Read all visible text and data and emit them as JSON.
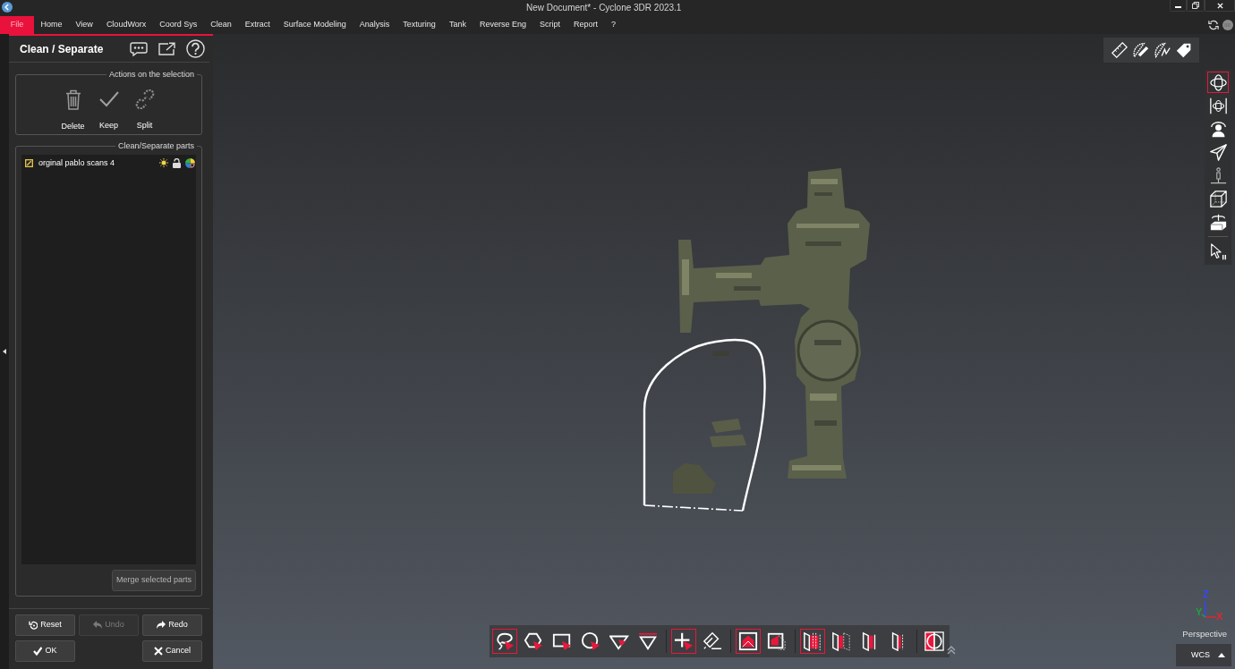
{
  "window": {
    "title": "New Document* - Cyclone 3DR 2023.1"
  },
  "menu": [
    {
      "label": "File",
      "selected": true
    },
    {
      "label": "Home",
      "selected": false
    },
    {
      "label": "View",
      "selected": false
    },
    {
      "label": "CloudWorx",
      "selected": false
    },
    {
      "label": "Coord Sys",
      "selected": false
    },
    {
      "label": "Clean",
      "selected": false
    },
    {
      "label": "Extract",
      "selected": false
    },
    {
      "label": "Surface Modeling",
      "selected": false
    },
    {
      "label": "Analysis",
      "selected": false
    },
    {
      "label": "Texturing",
      "selected": false
    },
    {
      "label": "Tank",
      "selected": false
    },
    {
      "label": "Reverse Eng",
      "selected": false
    },
    {
      "label": "Script",
      "selected": false
    },
    {
      "label": "Report",
      "selected": false
    },
    {
      "label": "?",
      "selected": false
    }
  ],
  "panel": {
    "title": "Clean / Separate",
    "actions": {
      "legend": "Actions on the selection",
      "buttons": [
        {
          "kind": "delete",
          "label": "Delete"
        },
        {
          "kind": "keep",
          "label": "Keep"
        },
        {
          "kind": "split",
          "label": "Split"
        }
      ]
    },
    "parts": {
      "legend": "Clean/Separate parts",
      "items": [
        {
          "name": "orginal pablo scans 4",
          "locked": false
        }
      ],
      "merge_button": "Merge selected parts"
    },
    "buttons": [
      {
        "kind": "reset",
        "label": "Reset",
        "disabled": false
      },
      {
        "kind": "undo",
        "label": "Undo",
        "disabled": true
      },
      {
        "kind": "redo",
        "label": "Redo",
        "disabled": false
      },
      {
        "kind": "ok",
        "label": "OK",
        "disabled": false
      },
      {
        "kind": "cancel",
        "label": "Cancel",
        "disabled": false
      }
    ]
  },
  "viewport": {
    "view_tool_groups": [
      {
        "tools": [
          {
            "kind": "orbit",
            "selected": true
          },
          {
            "kind": "orbit-bounded",
            "selected": false
          },
          {
            "kind": "person-orbit",
            "selected": false
          },
          {
            "kind": "plane",
            "selected": false
          },
          {
            "kind": "person-ground",
            "selected": false
          },
          {
            "kind": "cube",
            "selected": false
          },
          {
            "kind": "box-rotate",
            "selected": false
          }
        ]
      },
      {
        "tools": [
          {
            "kind": "pointer",
            "selected": false
          }
        ]
      }
    ],
    "selection_tool_groups": [
      {
        "tools": [
          {
            "kind": "lasso",
            "selected": true
          },
          {
            "kind": "polygon",
            "selected": false
          },
          {
            "kind": "rectangle",
            "selected": false
          },
          {
            "kind": "circle",
            "selected": false
          },
          {
            "kind": "triangle",
            "selected": false
          },
          {
            "kind": "triangle-line",
            "selected": false
          }
        ]
      },
      {
        "tools": [
          {
            "kind": "add",
            "selected": true
          },
          {
            "kind": "erase",
            "selected": false
          }
        ]
      },
      {
        "tools": [
          {
            "kind": "inside",
            "selected": true
          },
          {
            "kind": "partial",
            "selected": false
          }
        ]
      },
      {
        "tools": [
          {
            "kind": "slab-double",
            "selected": true
          },
          {
            "kind": "slab-forward",
            "selected": false
          },
          {
            "kind": "slab-center",
            "selected": false
          },
          {
            "kind": "slab-back",
            "selected": false
          }
        ]
      },
      {
        "tools": [
          {
            "kind": "split-view",
            "selected": false
          }
        ]
      }
    ],
    "axes": [
      {
        "label": "Z",
        "color": "#3348ff"
      },
      {
        "label": "Y",
        "color": "#22a33c"
      },
      {
        "label": "X",
        "color": "#e3262e"
      }
    ],
    "projection": "Perspective",
    "coordinate_system": "WCS"
  }
}
